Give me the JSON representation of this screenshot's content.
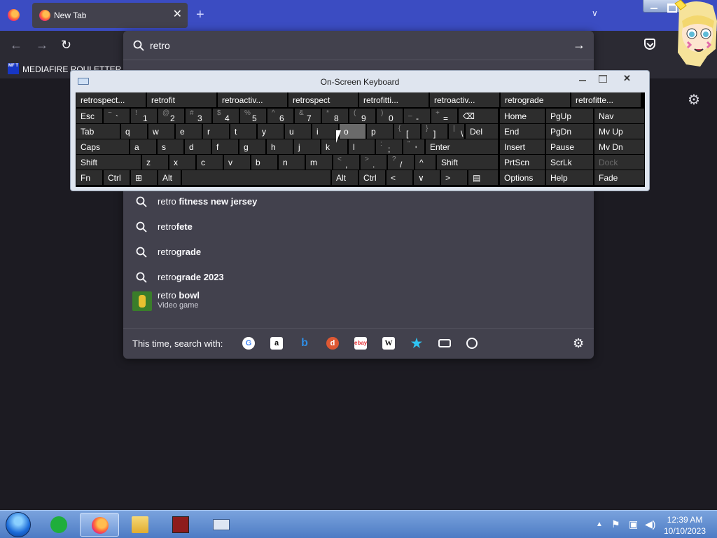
{
  "browser": {
    "tab_title": "New Tab",
    "tab_close": "✕",
    "new_tab": "+",
    "tab_list": "∨",
    "back": "←",
    "forward": "→",
    "reload": "↻",
    "bookmark_label": "MEDIAFIRE ROULETTER",
    "bookmark_icon_text": "MF T",
    "settings_icon": "⚙"
  },
  "urlbar": {
    "value": "retro",
    "go": "→"
  },
  "suggestions": [
    {
      "prefix": "retro",
      "bold": " fitness new jersey"
    },
    {
      "prefix": "retro",
      "bold": "fete"
    },
    {
      "prefix": "retro",
      "bold": "grade"
    },
    {
      "prefix": "retro",
      "bold": "grade 2023"
    }
  ],
  "game_suggestion": {
    "prefix": "retro ",
    "bold": "bowl",
    "subtitle": "Video game"
  },
  "engines": {
    "label": "This time, search with:",
    "items": [
      "google",
      "amazon",
      "bing",
      "duckduckgo",
      "ebay",
      "wikipedia",
      "bookmarks",
      "tabs",
      "history"
    ],
    "settings": "⚙"
  },
  "osk": {
    "title": "On-Screen Keyboard",
    "predictions": [
      "retrospect...",
      "retrofit",
      "retroactiv...",
      "retrospect",
      "retrofitti...",
      "retroactiv...",
      "retrograde",
      "retrofitte..."
    ],
    "row1": [
      {
        "main": "Esc"
      },
      {
        "sec": "~",
        "main": "`"
      },
      {
        "sec": "!",
        "main": "1"
      },
      {
        "sec": "@",
        "main": "2"
      },
      {
        "sec": "#",
        "main": "3"
      },
      {
        "sec": "$",
        "main": "4"
      },
      {
        "sec": "%",
        "main": "5"
      },
      {
        "sec": "^",
        "main": "6"
      },
      {
        "sec": "&",
        "main": "7"
      },
      {
        "sec": "*",
        "main": "8"
      },
      {
        "sec": "(",
        "main": "9"
      },
      {
        "sec": ")",
        "main": "0"
      },
      {
        "sec": "_",
        "main": "-"
      },
      {
        "sec": "+",
        "main": "="
      },
      {
        "main": "⌫"
      }
    ],
    "row2": [
      {
        "main": "Tab"
      },
      {
        "main": "q"
      },
      {
        "main": "w"
      },
      {
        "main": "e"
      },
      {
        "main": "r"
      },
      {
        "main": "t"
      },
      {
        "main": "y"
      },
      {
        "main": "u"
      },
      {
        "main": "i"
      },
      {
        "main": "o"
      },
      {
        "main": "p"
      },
      {
        "sec": "{",
        "main": "["
      },
      {
        "sec": "}",
        "main": "]"
      },
      {
        "sec": "|",
        "main": "\\"
      },
      {
        "main": "Del"
      }
    ],
    "row3": [
      {
        "main": "Caps"
      },
      {
        "main": "a"
      },
      {
        "main": "s"
      },
      {
        "main": "d"
      },
      {
        "main": "f"
      },
      {
        "main": "g"
      },
      {
        "main": "h"
      },
      {
        "main": "j"
      },
      {
        "main": "k"
      },
      {
        "main": "l"
      },
      {
        "sec": ":",
        "main": ";"
      },
      {
        "sec": "\"",
        "main": "'"
      },
      {
        "main": "Enter"
      }
    ],
    "row4": [
      {
        "main": "Shift"
      },
      {
        "main": "z"
      },
      {
        "main": "x"
      },
      {
        "main": "c"
      },
      {
        "main": "v"
      },
      {
        "main": "b"
      },
      {
        "main": "n"
      },
      {
        "main": "m"
      },
      {
        "sec": "<",
        "main": ","
      },
      {
        "sec": ">",
        "main": "."
      },
      {
        "sec": "?",
        "main": "/"
      },
      {
        "main": "^"
      },
      {
        "main": "Shift"
      }
    ],
    "row5": [
      {
        "main": "Fn"
      },
      {
        "main": "Ctrl"
      },
      {
        "main": "⊞"
      },
      {
        "main": "Alt"
      },
      {
        "main": ""
      },
      {
        "main": "Alt"
      },
      {
        "main": "Ctrl"
      },
      {
        "main": "<"
      },
      {
        "main": "∨"
      },
      {
        "main": ">"
      },
      {
        "main": "▤"
      }
    ],
    "nav": [
      [
        "Home",
        "PgUp",
        "Nav"
      ],
      [
        "End",
        "PgDn",
        "Mv Up"
      ],
      [
        "Insert",
        "Pause",
        "Mv Dn"
      ],
      [
        "PrtScn",
        "ScrLk",
        "Dock"
      ],
      [
        "Options",
        "Help",
        "Fade"
      ]
    ]
  },
  "taskbar": {
    "time": "12:39 AM",
    "date": "10/10/2023",
    "tray_arrow": "▲"
  }
}
